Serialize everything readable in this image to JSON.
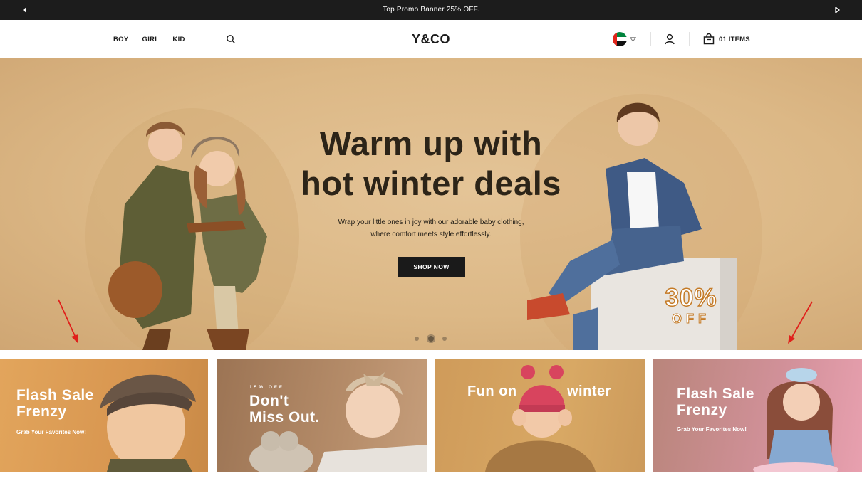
{
  "promo": {
    "text": "Top Promo Banner 25% OFF.",
    "prev_icon": "chevron-left-icon",
    "next_icon": "chevron-right-icon"
  },
  "header": {
    "nav": [
      "BOY",
      "GIRL",
      "KID"
    ],
    "logo": "Y&CO",
    "country_flag": "uae-flag",
    "cart_label": "01 ITEMS"
  },
  "hero": {
    "title_line1": "Warm up with",
    "title_line2": "hot winter deals",
    "subtitle_line1": "Wrap your little ones in joy with our adorable baby clothing,",
    "subtitle_line2": "where comfort meets style effortlessly.",
    "cta": "SHOP NOW",
    "badge_big": "30%",
    "badge_small": "OFF",
    "slides_total": 3,
    "active_slide": 2
  },
  "cards": [
    {
      "title_line1": "Flash Sale",
      "title_line2": "Frenzy",
      "subtitle": "Grab Your Favorites Now!"
    },
    {
      "kicker": "15% OFF",
      "title_line1": "Don't",
      "title_line2": "Miss Out."
    },
    {
      "title_left": "Fun on",
      "title_right": "winter"
    },
    {
      "title_line1": "Flash Sale",
      "title_line2": "Frenzy",
      "subtitle": "Grab Your Favorites Now!"
    }
  ],
  "colors": {
    "promo_bg": "#1c1c1c",
    "hero_bg": "#dcb886",
    "button_bg": "#1a1a1a",
    "arrow": "#e0201b"
  }
}
